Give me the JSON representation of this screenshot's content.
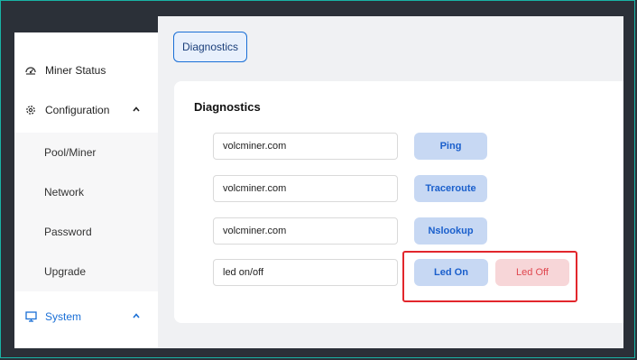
{
  "sidebar": {
    "miner_status": "Miner Status",
    "configuration": "Configuration",
    "sub_items": [
      "Pool/Miner",
      "Network",
      "Password",
      "Upgrade"
    ],
    "system": "System"
  },
  "tab": {
    "label": "Diagnostics"
  },
  "card": {
    "title": "Diagnostics"
  },
  "rows": [
    {
      "input_value": "volcminer.com",
      "button": "Ping"
    },
    {
      "input_value": "volcminer.com",
      "button": "Traceroute"
    },
    {
      "input_value": "volcminer.com",
      "button": "Nslookup"
    },
    {
      "input_value": "led on/off",
      "button_on": "Led On",
      "button_off": "Led Off"
    }
  ],
  "colors": {
    "accent": "#1a6fd6",
    "frame": "#19b3a5",
    "highlight": "#e2262c",
    "led_off": "#e0474f"
  }
}
